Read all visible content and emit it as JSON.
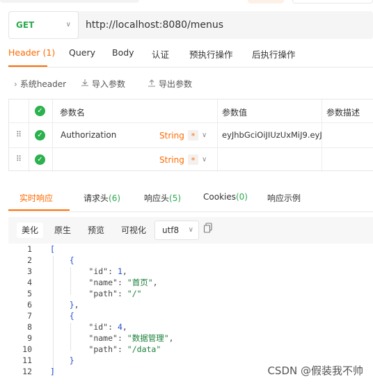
{
  "request": {
    "method": "GET",
    "url": "http://localhost:8080/menus"
  },
  "request_tabs": [
    {
      "label": "Header (1)"
    },
    {
      "label": "Query"
    },
    {
      "label": "Body"
    },
    {
      "label": "认证"
    },
    {
      "label": "预执行操作"
    },
    {
      "label": "后执行操作"
    }
  ],
  "tools": {
    "system_header": "系统header",
    "import": "导入参数",
    "export": "导出参数"
  },
  "params": {
    "columns": [
      "参数名",
      "参数值",
      "参数描述"
    ],
    "rows": [
      {
        "name": "Authorization",
        "type": "String",
        "required": "*",
        "value": "eyJhbGciOiJIUzUxMiJ9.eyJ",
        "desc": ""
      },
      {
        "name": "",
        "type": "String",
        "required": "*",
        "value": "",
        "desc": ""
      }
    ]
  },
  "response_tabs": {
    "realtime": "实时响应",
    "req_headers": "请求头",
    "req_headers_count": "(6)",
    "resp_headers": "响应头",
    "resp_headers_count": "(5)",
    "cookies": "Cookies",
    "cookies_count": "(0)",
    "example": "响应示例"
  },
  "view": {
    "pretty": "美化",
    "raw": "原生",
    "preview": "预览",
    "visualize": "可视化",
    "encoding": "utf8"
  },
  "code": {
    "line_numbers": [
      "1",
      "2",
      "3",
      "4",
      "5",
      "6",
      "7",
      "8",
      "9",
      "10",
      "11",
      "12"
    ],
    "items": [
      {
        "id": "1",
        "name": "首页",
        "path": "/"
      },
      {
        "id": "4",
        "name": "数据管理",
        "path": "/data"
      }
    ]
  },
  "watermark": "CSDN @假装我不帅",
  "colors": {
    "accent": "#ff6a00",
    "green": "#2ca94f",
    "json_bracket": "#1f4bd0",
    "json_string": "#1a7f37"
  }
}
